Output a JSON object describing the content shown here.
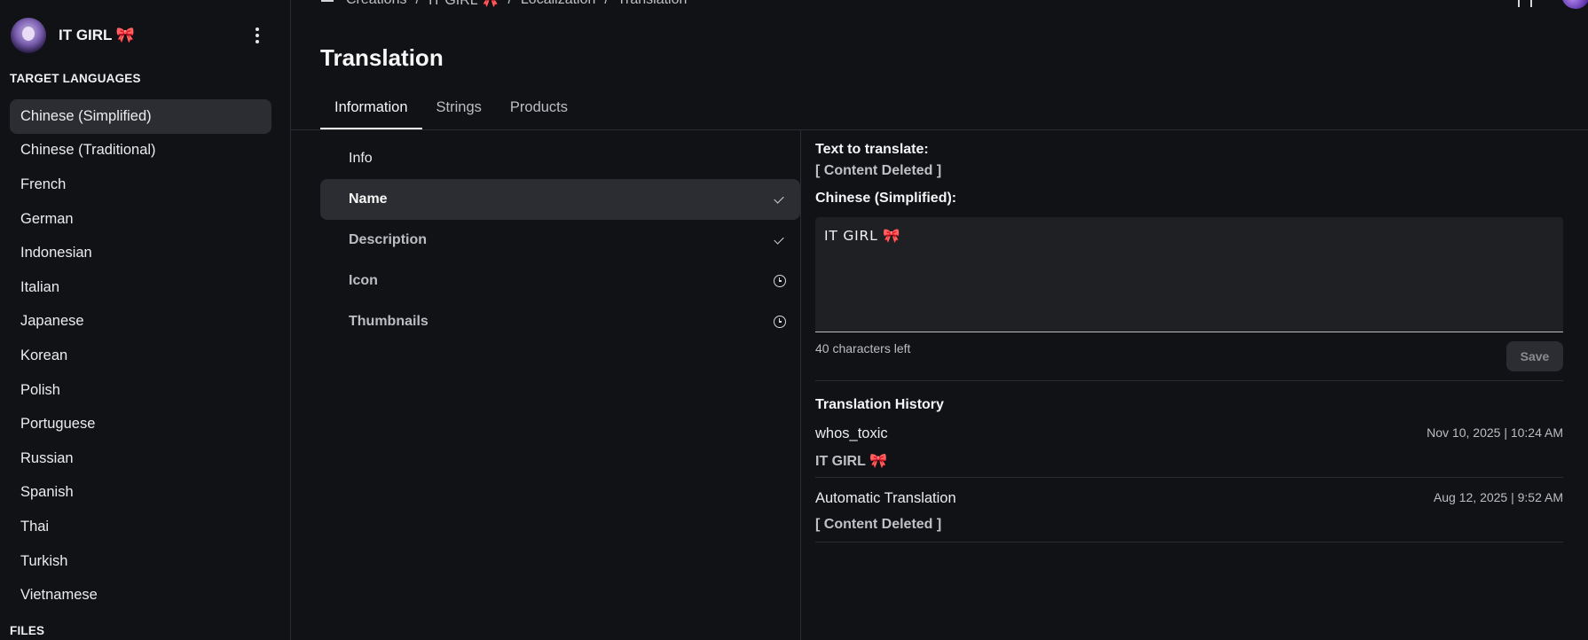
{
  "sidebar": {
    "experience_name": "IT GIRL 🎀",
    "target_languages_label": "TARGET LANGUAGES",
    "languages": [
      "Chinese (Simplified)",
      "Chinese (Traditional)",
      "French",
      "German",
      "Indonesian",
      "Italian",
      "Japanese",
      "Korean",
      "Polish",
      "Portuguese",
      "Russian",
      "Spanish",
      "Thai",
      "Turkish",
      "Vietnamese"
    ],
    "active_language": "Chinese (Simplified)",
    "files_label": "FILES"
  },
  "breadcrumb": [
    "Creations",
    "IT GIRL 🎀",
    "Localization",
    "Translation"
  ],
  "page_title": "Translation",
  "tabs": [
    "Information",
    "Strings",
    "Products"
  ],
  "active_tab": "Information",
  "fields": [
    {
      "label": "Info",
      "status": ""
    },
    {
      "label": "Name",
      "status": "check-icon"
    },
    {
      "label": "Description",
      "status": "check-icon"
    },
    {
      "label": "Icon",
      "status": "clock-icon"
    },
    {
      "label": "Thumbnails",
      "status": "clock-icon"
    }
  ],
  "editor": {
    "text_to_translate_label": "Text to translate:",
    "source_text": "[ Content Deleted ]",
    "target_label": "Chinese (Simplified):",
    "translation_value": "IT GIRL 🎀",
    "chars_left": "40 characters left",
    "save_label": "Save"
  },
  "history": {
    "title": "Translation History",
    "entries": [
      {
        "author": "whos_toxic",
        "date": "Nov 10, 2025 | 10:24 AM",
        "text": "IT GIRL 🎀"
      },
      {
        "author": "Automatic Translation",
        "date": "Aug 12, 2025 | 9:52 AM",
        "text": "[ Content Deleted ]"
      }
    ]
  },
  "colors": {
    "background": "#111216",
    "panel": "#1f2024",
    "active": "#2c2d32",
    "accent_emoji": "#ff5aa5"
  }
}
